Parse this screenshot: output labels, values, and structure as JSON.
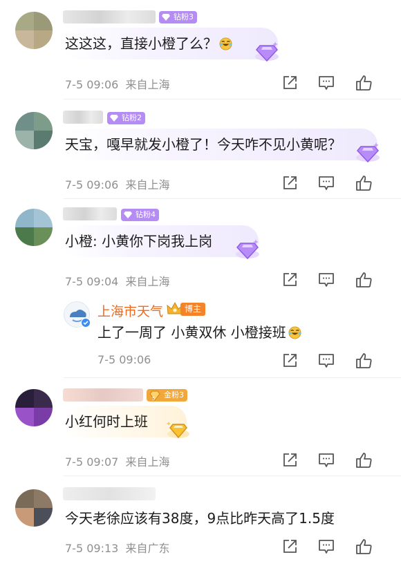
{
  "comments": [
    {
      "badge": "钻粉3",
      "text": "这这这，直接小橙了么？",
      "time": "7-5 09:06",
      "loc": "来自上海",
      "emoji": "laughing-tears-icon"
    },
    {
      "badge": "钻粉2",
      "text": "天宝，嘎早就发小橙了！今天咋不见小黄呢？",
      "time": "7-5 09:06",
      "loc": "来自上海"
    },
    {
      "badge": "钻粉4",
      "text": "小橙: 小黄你下岗我上岗",
      "time": "7-5 09:04",
      "loc": "来自上海"
    },
    {
      "badge": "金粉3",
      "badge_level": "5",
      "text": "小红何时上班",
      "time": "7-5 09:07",
      "loc": "来自上海"
    },
    {
      "text": "今天老徐应该有38度，9点比昨天高了1.5度",
      "time": "7-5 09:13",
      "loc": "来自广东"
    }
  ],
  "reply": {
    "author": "上海市天气",
    "role": "博主",
    "text": "上了一周了 小黄双休 小橙接班",
    "time": "7-5 09:06",
    "emoji": "laughing-tears-icon"
  },
  "colors": {
    "diamond_badge": "#b286f5",
    "gold_badge": "#f2a93b",
    "author_name": "#ee6a1e",
    "blogger_tag": "#f3842b"
  },
  "icons": {
    "share": "share-icon",
    "comment": "comment-icon",
    "like": "thumbs-up-icon"
  }
}
